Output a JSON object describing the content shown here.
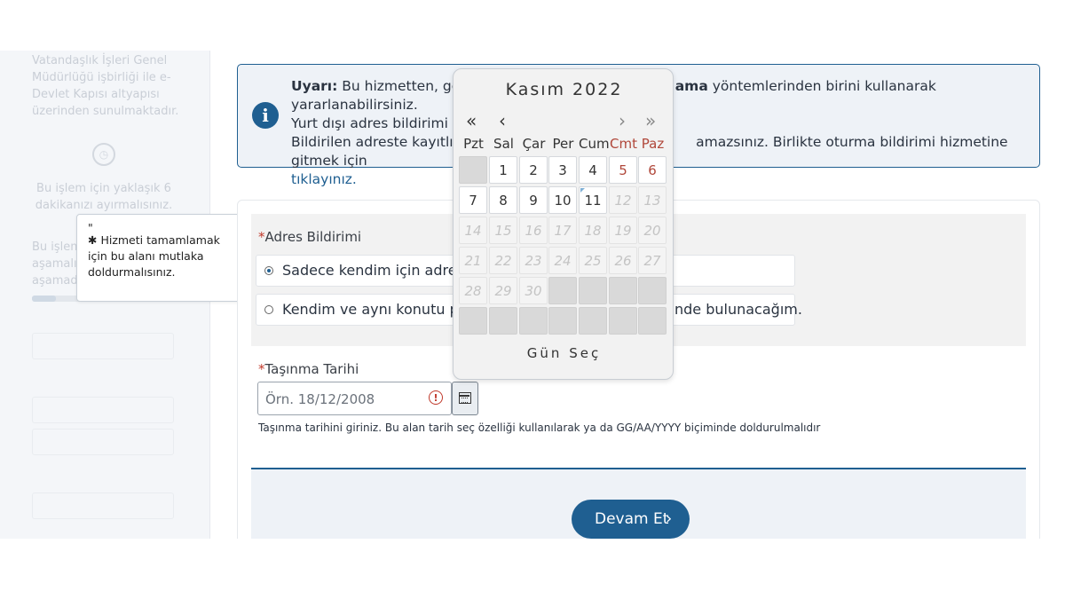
{
  "sidebar": {
    "intro": "Vatandaşlık İşleri Genel Müdürlüğü işbirliği ile e-Devlet Kapısı altyapısı üzerinden sunulmaktadır.",
    "time_text": "Bu işlem için yaklaşık 6 dakikanızı ayırmalısınız.",
    "steps_text": "Bu işlem aşamalı aşamad",
    "progress_fraction": 0.17
  },
  "tooltip": {
    "quote": "\"",
    "text": "✱ Hizmeti tamamlamak için bu alanı mutlaka doldurmalısınız."
  },
  "warning": {
    "icon": "info-icon",
    "label": "Uyarı:",
    "line1_a": " Bu hizmetten, geçer",
    "line1_bold": "ama",
    "line1_b": " yöntemlerinden birini kullanarak yararlanabilirsiniz.",
    "line2": "Yurt dışı adres bildirimi için",
    "line3_a": "Bildirilen adreste kayıtlı kişi",
    "line3_b": "amazsınız. Birlikte oturma bildirimi hizmetine gitmek için",
    "link": "tıklayınız."
  },
  "form": {
    "address_label_req": "*",
    "address_label": "Adres Bildirimi",
    "option1": "Sadece kendim için adres bil",
    "option2": "Kendim ve aynı konutu payla",
    "option2_tail": "nde bulunacağım.",
    "date_label_req": "*",
    "date_label": "Taşınma Tarihi",
    "date_placeholder": "Örn. 18/12/2008",
    "date_value": "",
    "hint": "Taşınma tarihini giriniz. Bu alan tarih seç özelliği kullanılarak ya da GG/AA/YYYY biçiminde doldurulmalıdır",
    "continue_label": "Devam Et",
    "continue_arrow": "›"
  },
  "calendar": {
    "title": "Kasım 2022",
    "nav_prev_year": "«",
    "nav_prev_month": "‹",
    "nav_next_month": "›",
    "nav_next_year": "»",
    "weekdays": [
      "Pzt",
      "Sal",
      "Çar",
      "Per",
      "Cum",
      "Cmt",
      "Paz"
    ],
    "weeks": [
      [
        "",
        "1",
        "2",
        "3",
        "4",
        "5",
        "6"
      ],
      [
        "7",
        "8",
        "9",
        "10",
        "11",
        "12",
        "13"
      ],
      [
        "14",
        "15",
        "16",
        "17",
        "18",
        "19",
        "20"
      ],
      [
        "21",
        "22",
        "23",
        "24",
        "25",
        "26",
        "27"
      ],
      [
        "28",
        "29",
        "30",
        "",
        "",
        "",
        ""
      ],
      [
        "",
        "",
        "",
        "",
        "",
        "",
        ""
      ]
    ],
    "today": "11",
    "footer": "Gün Seç"
  }
}
